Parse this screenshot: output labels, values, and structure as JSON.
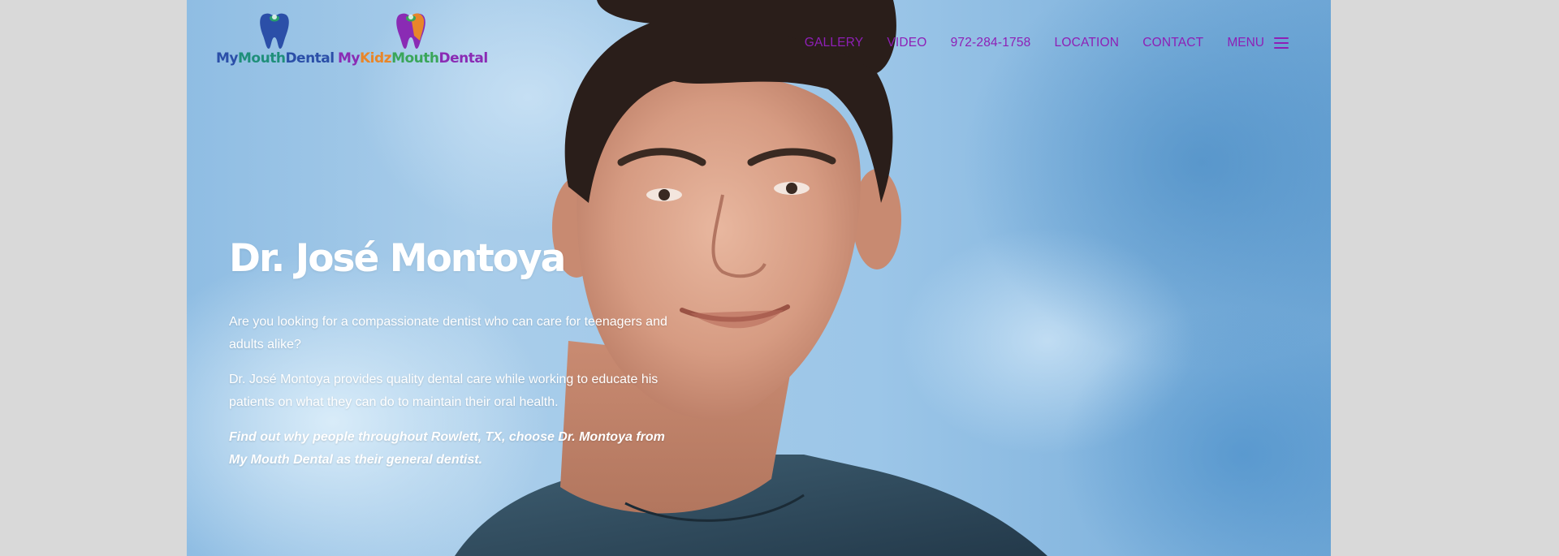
{
  "brand": {
    "logo1": {
      "my": "My",
      "mouth": "Mouth",
      "dental": "Dental"
    },
    "logo2": {
      "my": "My",
      "kidz": "Kidz",
      "mouth": "Mouth",
      "dental": "Dental"
    }
  },
  "nav": {
    "items": [
      {
        "label": "GALLERY"
      },
      {
        "label": "VIDEO"
      },
      {
        "label": "972-284-1758"
      },
      {
        "label": "LOCATION"
      },
      {
        "label": "CONTACT"
      }
    ],
    "menu_label": "MENU",
    "menu_icon": "hamburger-icon"
  },
  "hero": {
    "title": "Dr. José Montoya",
    "paragraph1": "Are you looking for a compassionate dentist who can care for teenagers and adults alike?",
    "paragraph2": "Dr. José Montoya provides quality dental care while working to educate his patients on what they can do to maintain their oral health.",
    "paragraph3": "Find out why people throughout Rowlett, TX, choose Dr. Montoya from My Mouth Dental as their general dentist."
  },
  "colors": {
    "nav_text": "#8e1fb6",
    "page_bg": "#d9d9d9",
    "hero_bg": "#9cc6e8"
  }
}
